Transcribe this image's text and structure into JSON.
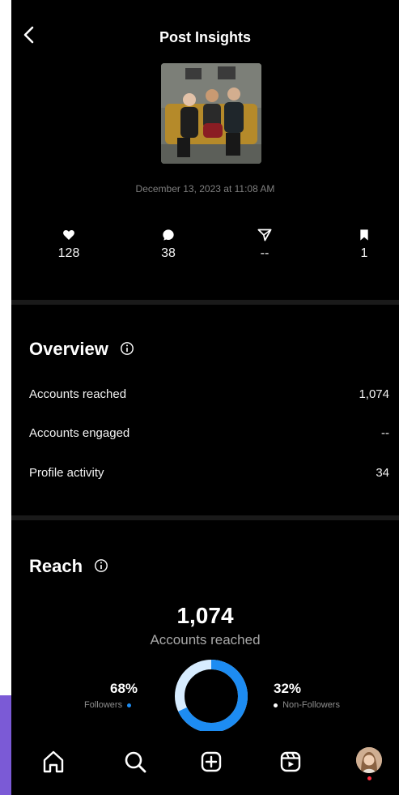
{
  "header": {
    "title": "Post Insights",
    "back_icon": "chevron-left-icon"
  },
  "post": {
    "date": "December 13, 2023 at 11:08 AM"
  },
  "stats": [
    {
      "icon": "heart-icon",
      "value": "128"
    },
    {
      "icon": "comment-icon",
      "value": "38"
    },
    {
      "icon": "share-icon",
      "value": "--"
    },
    {
      "icon": "bookmark-icon",
      "value": "1"
    }
  ],
  "overview": {
    "title": "Overview",
    "rows": [
      {
        "label": "Accounts reached",
        "value": "1,074"
      },
      {
        "label": "Accounts engaged",
        "value": "--"
      },
      {
        "label": "Profile activity",
        "value": "34"
      }
    ]
  },
  "reach": {
    "title": "Reach",
    "total": "1,074",
    "total_label": "Accounts reached",
    "followers": {
      "pct": "68%",
      "label": "Followers",
      "fraction": 0.68,
      "color": "#1d8cf2"
    },
    "non_followers": {
      "pct": "32%",
      "label": "Non-Followers",
      "fraction": 0.32,
      "color": "#d7ecff"
    }
  },
  "tabbar": [
    "home-icon",
    "search-icon",
    "create-icon",
    "reels-icon",
    "profile-avatar"
  ]
}
